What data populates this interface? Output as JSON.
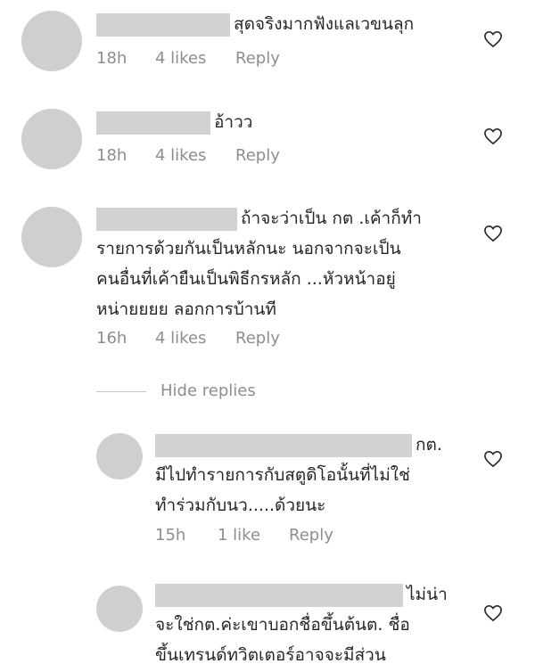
{
  "comments": [
    {
      "lines": [
        "สุดจริงมากฟังแลเวขนลุก"
      ],
      "time": "18h",
      "likes": "4 likes",
      "reply": "Reply"
    },
    {
      "lines": [
        "อ้าวว"
      ],
      "time": "18h",
      "likes": "4 likes",
      "reply": "Reply"
    },
    {
      "lines": [
        "ถ้าจะว่าเป็น กต .เค้าก็ทำ",
        "รายการด้วยกันเป็นหลักนะ นอกจากจะเป็น",
        "คนอื่นที่เค้ายืนเป็นพิธีกรหลัก ...หัวหน้าอยู่",
        "หน่ายยยย ลอกการบ้านที"
      ],
      "time": "16h",
      "likes": "4 likes",
      "reply": "Reply"
    }
  ],
  "hide_replies": "Hide replies",
  "replies": [
    {
      "lines": [
        "กต.",
        "มีไปทำรายการกับสตูดิโอนั้นที่ไม่ใช่",
        "ทำร่วมกับนว.....ด้วยนะ"
      ],
      "time": "15h",
      "likes": "1 like",
      "reply": "Reply"
    },
    {
      "lines": [
        "ไม่น่า",
        "จะใช่กต.ค่ะเขาบอกชื่อขึ้นต้นต. ชื่อ",
        "ขึ้นเทรนด์ทวิตเตอร์อาจจะมีส่วน"
      ]
    }
  ],
  "icons": {
    "like": "heart-outline-icon"
  },
  "colors": {
    "text": "#262626",
    "meta": "#8e8e8e",
    "placeholder": "#cfcfcf"
  }
}
